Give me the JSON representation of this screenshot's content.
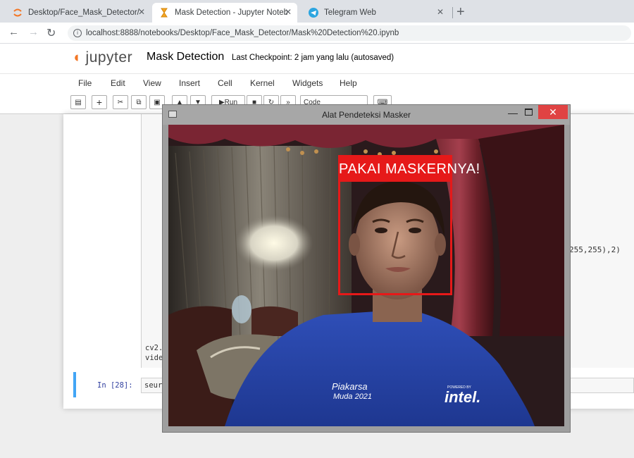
{
  "browser": {
    "tabs": [
      {
        "label": "Desktop/Face_Mask_Detector/",
        "icon": "jupyter-orb-icon",
        "active": false
      },
      {
        "label": "Mask Detection - Jupyter Notebo",
        "icon": "hourglass-icon",
        "active": true
      },
      {
        "label": "Telegram Web",
        "icon": "telegram-icon",
        "active": false
      }
    ],
    "url": "localhost:8888/notebooks/Desktop/Face_Mask_Detector/Mask%20Detection%20.ipynb"
  },
  "jupyter": {
    "logo": "jupyter",
    "notebook_title": "Mask Detection",
    "checkpoint": "Last Checkpoint: 2 jam yang lalu  (autosaved)",
    "menu": [
      "File",
      "Edit",
      "View",
      "Insert",
      "Cell",
      "Kernel",
      "Widgets",
      "Help"
    ],
    "toolbar": {
      "run_label": "Run",
      "cell_type": "Code"
    },
    "code_visible": {
      "line_tail": "255,255),2)",
      "line_a": "cv2.",
      "line_b": "vide"
    },
    "cell2": {
      "prompt": "In [28]:",
      "code": "seur"
    }
  },
  "cv_window": {
    "title": "Alat Pendeteksi Masker",
    "detection_label": "PAKAI MASKERNYA!",
    "detection_color": "#e61919",
    "shirt_text_line1": "Piakarsa",
    "shirt_text_line2": "Muda 2021",
    "shirt_small_text": "POWERED BY",
    "shirt_brand": "intel."
  }
}
